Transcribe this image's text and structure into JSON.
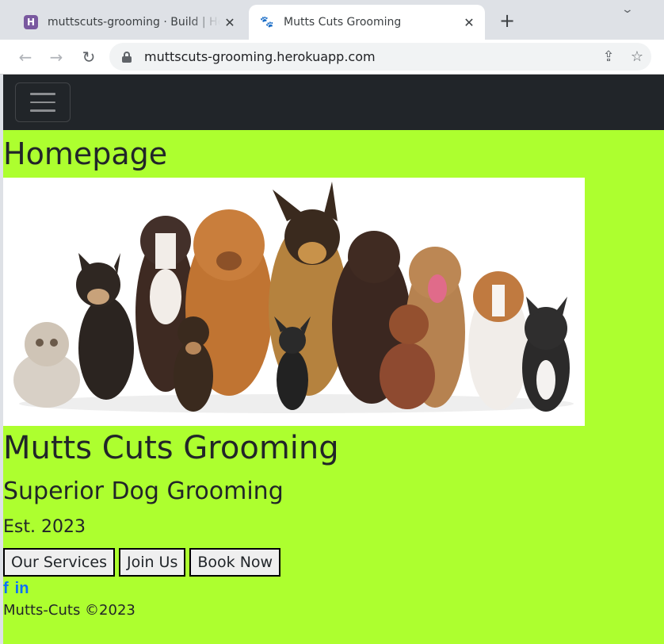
{
  "browser": {
    "tabs": [
      {
        "title": "muttscuts-grooming · Build | Heroku",
        "favicon": "heroku-icon",
        "active": false
      },
      {
        "title": "Mutts Cuts Grooming",
        "favicon": "paw-icon",
        "active": true
      }
    ],
    "url": "muttscuts-grooming.herokuapp.com"
  },
  "page": {
    "background": "#adff2f",
    "navbar_color": "#212529",
    "heading": "Homepage",
    "hero_alt": "group of dogs",
    "brand": "Mutts Cuts Grooming",
    "tagline": "Superior Dog Grooming",
    "established": "Est. 2023",
    "buttons": [
      "Our Services",
      "Join Us",
      "Book Now"
    ],
    "social": [
      {
        "icon": "facebook-icon",
        "glyph": "f"
      },
      {
        "icon": "linkedin-icon",
        "glyph": "in"
      }
    ],
    "footer": "Mutts-Cuts ©2023",
    "link_color": "#0d6efd"
  }
}
